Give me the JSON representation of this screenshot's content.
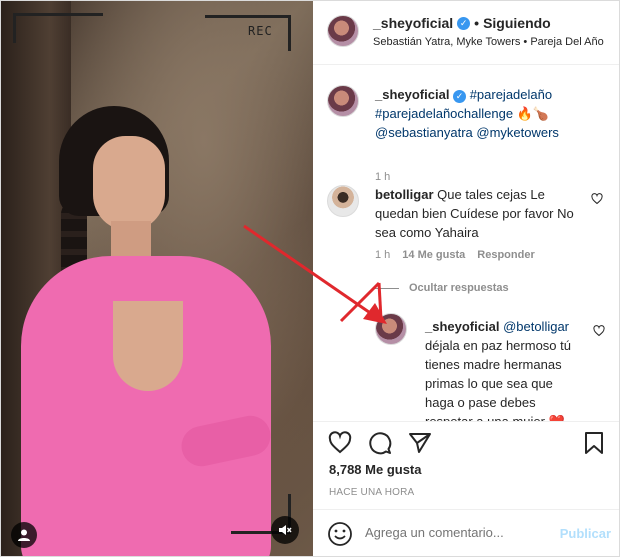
{
  "video": {
    "rec_label": "REC"
  },
  "header": {
    "username": "_sheyoficial",
    "verified_glyph": "✓",
    "separator": "•",
    "follow_status": "Siguiendo",
    "audio": "Sebastián Yatra, Myke Towers • Pareja Del Año"
  },
  "caption": {
    "username": "_sheyoficial",
    "tag1": "#parejadelaño",
    "tag2": "#parejadelañochallenge",
    "emojis": "🔥🍗",
    "mention1": "@sebastianyatra",
    "mention2": "@myketowers",
    "time": "1 h"
  },
  "comment1": {
    "username": "betolligar",
    "text": "Que tales cejas Le quedan bien Cuídese por favor No sea como Yahaira",
    "time": "1 h",
    "likes": "14 Me gusta",
    "reply": "Responder"
  },
  "hide_replies": "Ocultar respuestas",
  "reply1": {
    "username": "_sheyoficial",
    "mention": "@betolligar",
    "text": "déjala en paz hermoso tú tienes madre hermanas primas lo que sea que haga o pase debes respetar a una mujer",
    "heart": "❤️"
  },
  "actions": {
    "likes": "8,788 Me gusta",
    "ago": "HACE UNA HORA",
    "comment_placeholder": "Agrega un comentario...",
    "publish": "Publicar"
  },
  "icons": [
    "heart-icon",
    "comment-icon",
    "share-icon",
    "bookmark-icon",
    "emoji-icon",
    "mute-icon",
    "user-icon",
    "verified-icon"
  ],
  "colors": {
    "verified_blue": "#3897f0",
    "link_blue": "#00376b",
    "publish_disabled": "#b2dffc",
    "arrow_red": "#e0282d",
    "outfit_pink": "#ef6bb0"
  }
}
